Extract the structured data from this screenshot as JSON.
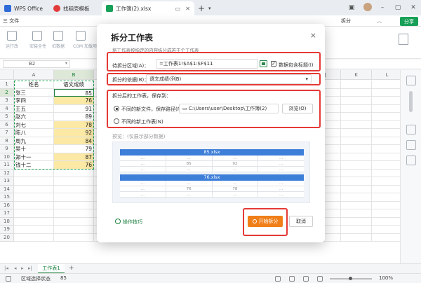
{
  "titlebar": {
    "tabs": [
      {
        "label": "WPS Office"
      },
      {
        "label": "找稻壳模板"
      },
      {
        "label": "工作簿(2).xlsx"
      }
    ],
    "new_tab": "+"
  },
  "menubar": {
    "file": "三 文件",
    "split_tab": "拆分",
    "share": "分享"
  },
  "toolbar": {
    "tools": [
      "运行改",
      "安装全性",
      "扣数据",
      "COM 加载项"
    ]
  },
  "formula": {
    "cell_ref": "B2"
  },
  "sheet": {
    "columns": [
      "A",
      "B",
      "C",
      "D",
      "E",
      "F",
      "G",
      "H",
      "I",
      "J",
      "K",
      "L",
      "M"
    ],
    "row_numbers": [
      "1",
      "2",
      "3",
      "4",
      "5",
      "6",
      "7",
      "8",
      "9",
      "10",
      "11",
      "12",
      "13",
      "14",
      "15",
      "16",
      "17",
      "18",
      "19",
      "20"
    ],
    "header": {
      "name": "姓名",
      "score": "语文成绩"
    },
    "rows": [
      {
        "name": "张三",
        "score": "85",
        "yellow": false
      },
      {
        "name": "李四",
        "score": "76",
        "yellow": true
      },
      {
        "name": "王五",
        "score": "91",
        "yellow": false
      },
      {
        "name": "赵六",
        "score": "89",
        "yellow": false
      },
      {
        "name": "刘七",
        "score": "78",
        "yellow": true
      },
      {
        "name": "陈八",
        "score": "92",
        "yellow": true
      },
      {
        "name": "周九",
        "score": "84",
        "yellow": true
      },
      {
        "name": "吴十",
        "score": "79",
        "yellow": false
      },
      {
        "name": "郑十一",
        "score": "87",
        "yellow": true
      },
      {
        "name": "钱十二",
        "score": "76",
        "yellow": true
      }
    ]
  },
  "sheettabs": {
    "active": "工作表1",
    "add": "+"
  },
  "status": {
    "mode": "区域选择状态",
    "value": "85",
    "zoom": "100%"
  },
  "dialog": {
    "title": "拆分工作表",
    "subtitle": "将工作表按指定的内容拆分成若干个工作表",
    "close": "×",
    "range_label": "待拆分区域(A)：",
    "range_value": "=工作表1!$A$1:$F$11",
    "header_checkbox": "数据包含标题(I)",
    "by_label": "拆分的依据(B)：",
    "by_value": "语文成绩(列B)",
    "save_label": "拆分后的工作表，保存到：",
    "opt_new_file": "不同的新文件，保存路径(P)",
    "path_value": "C:\\Users\\user\\Desktop\\工作簿(2)",
    "browse": "浏览(O)",
    "opt_new_sheet": "不同的新工作表(N)",
    "preview_label": "预览：(仅展示部分数据)",
    "preview": [
      {
        "title": "85.xlsx",
        "rows": [
          [
            "...",
            "...",
            "...",
            "..."
          ],
          [
            "...",
            "85",
            "92",
            "..."
          ],
          [
            "...",
            "...",
            "...",
            "..."
          ]
        ]
      },
      {
        "title": "76.xlsx",
        "rows": [
          [
            "...",
            "...",
            "...",
            "..."
          ],
          [
            "...",
            "76",
            "78",
            "..."
          ],
          [
            "...",
            "...",
            "...",
            "..."
          ]
        ]
      }
    ],
    "tips": "操作技巧",
    "start": "开始拆分",
    "cancel": "取消"
  },
  "colors": {
    "accent_green": "#1a7f3c",
    "highlight_red": "#e53935",
    "start_orange": "#f07f1a",
    "cell_yellow": "#fbe9a5",
    "preview_blue": "#3d7ed8"
  }
}
